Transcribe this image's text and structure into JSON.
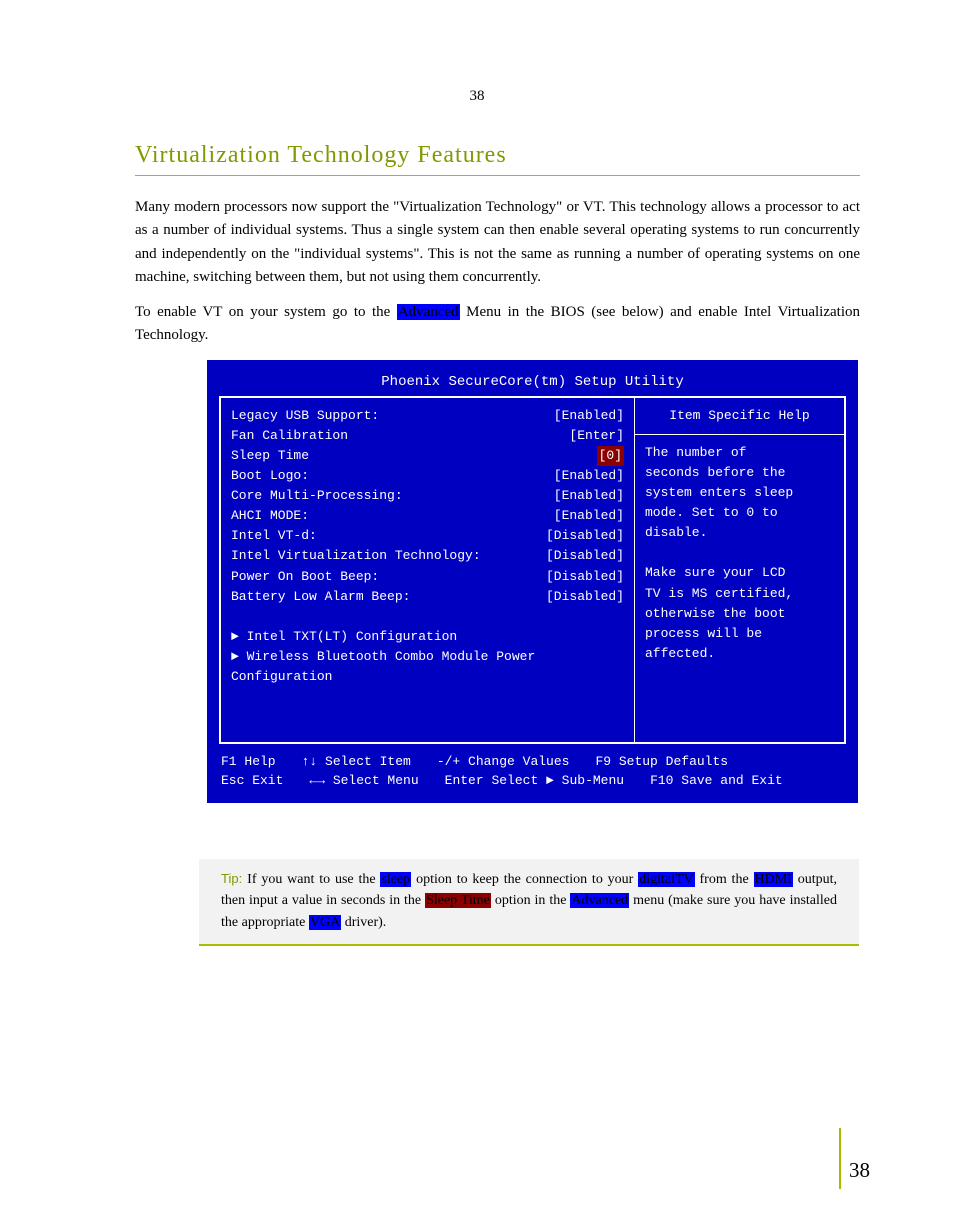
{
  "page": {
    "top_number": "38",
    "side_number": "38"
  },
  "section": {
    "heading": "Virtualization Technology Features"
  },
  "paragraphs": {
    "p1": "Many modern processors now support the \"Virtualization Technology\" or VT. This technology allows a processor to act as a number of individual systems. Thus a single system can then enable several operating systems to run concurrently and independently on the \"individual systems\". This is not the same as running a number of operating systems on one machine, switching between them, but not using them concurrently.",
    "p2_pre": "To enable VT on your system go to the ",
    "p2_hl": "Advanced",
    "p2_post": " Menu in the BIOS (see below) and enable Intel Virtualization Technology."
  },
  "bios": {
    "title": "Phoenix SecureCore(tm) Setup Utility",
    "left": {
      "rows": [
        {
          "key": "Legacy USB Support:",
          "val": "[Enabled]",
          "sel": false
        },
        {
          "key": "Fan Calibration",
          "val": "[Enter]",
          "sel": false
        },
        {
          "key": "Sleep Time",
          "val": "[0]",
          "sel": true
        },
        {
          "key": "Boot Logo:",
          "val": "[Enabled]",
          "sel": false
        },
        {
          "key": "Core Multi-Processing:",
          "val": "[Enabled]",
          "sel": false
        },
        {
          "key": "AHCI MODE:",
          "val": "[Enabled]",
          "sel": false
        },
        {
          "key": "Intel VT-d:",
          "val": "[Disabled]",
          "sel": false
        },
        {
          "key": "Intel Virtualization Technology:",
          "val": "[Disabled]",
          "sel": false
        },
        {
          "key": "Power On Boot Beep:",
          "val": "[Disabled]",
          "sel": false
        },
        {
          "key": "Battery Low Alarm Beep:",
          "val": "[Disabled]",
          "sel": false
        }
      ],
      "tail": "\n► Intel TXT(LT) Configuration\n► Wireless Bluetooth Combo Module Power Configuration"
    },
    "right_top": "Item Specific Help",
    "right_bottom": "The number of\nseconds before the\nsystem enters sleep\nmode. Set to 0 to\ndisable.\n\nMake sure your LCD\nTV is MS certified,\notherwise the boot\nprocess will be\naffected.",
    "footer": {
      "row1": [
        "F1   Help",
        "↑↓  Select Item",
        "-/+  Change Values",
        "F9   Setup Defaults"
      ],
      "row2": [
        "Esc  Exit",
        "←→ Select Menu",
        "Enter Select ► Sub-Menu",
        "F10  Save and Exit"
      ]
    }
  },
  "tip": {
    "label": "Tip: ",
    "t1": "If you want to use the ",
    "hl1": "sleep",
    "t2": " option to keep the connection to your ",
    "hl2": "digitalTV",
    "t3": " from the ",
    "hl3": "HDMI",
    "t4": " output, then input a value in seconds in the ",
    "hl5": "Sleep Time",
    "t5": " option in the ",
    "hl6": "Advanced",
    "t6": " menu (make sure you have installed the appropriate ",
    "hl7": "VGA",
    "t7": " driver)."
  }
}
